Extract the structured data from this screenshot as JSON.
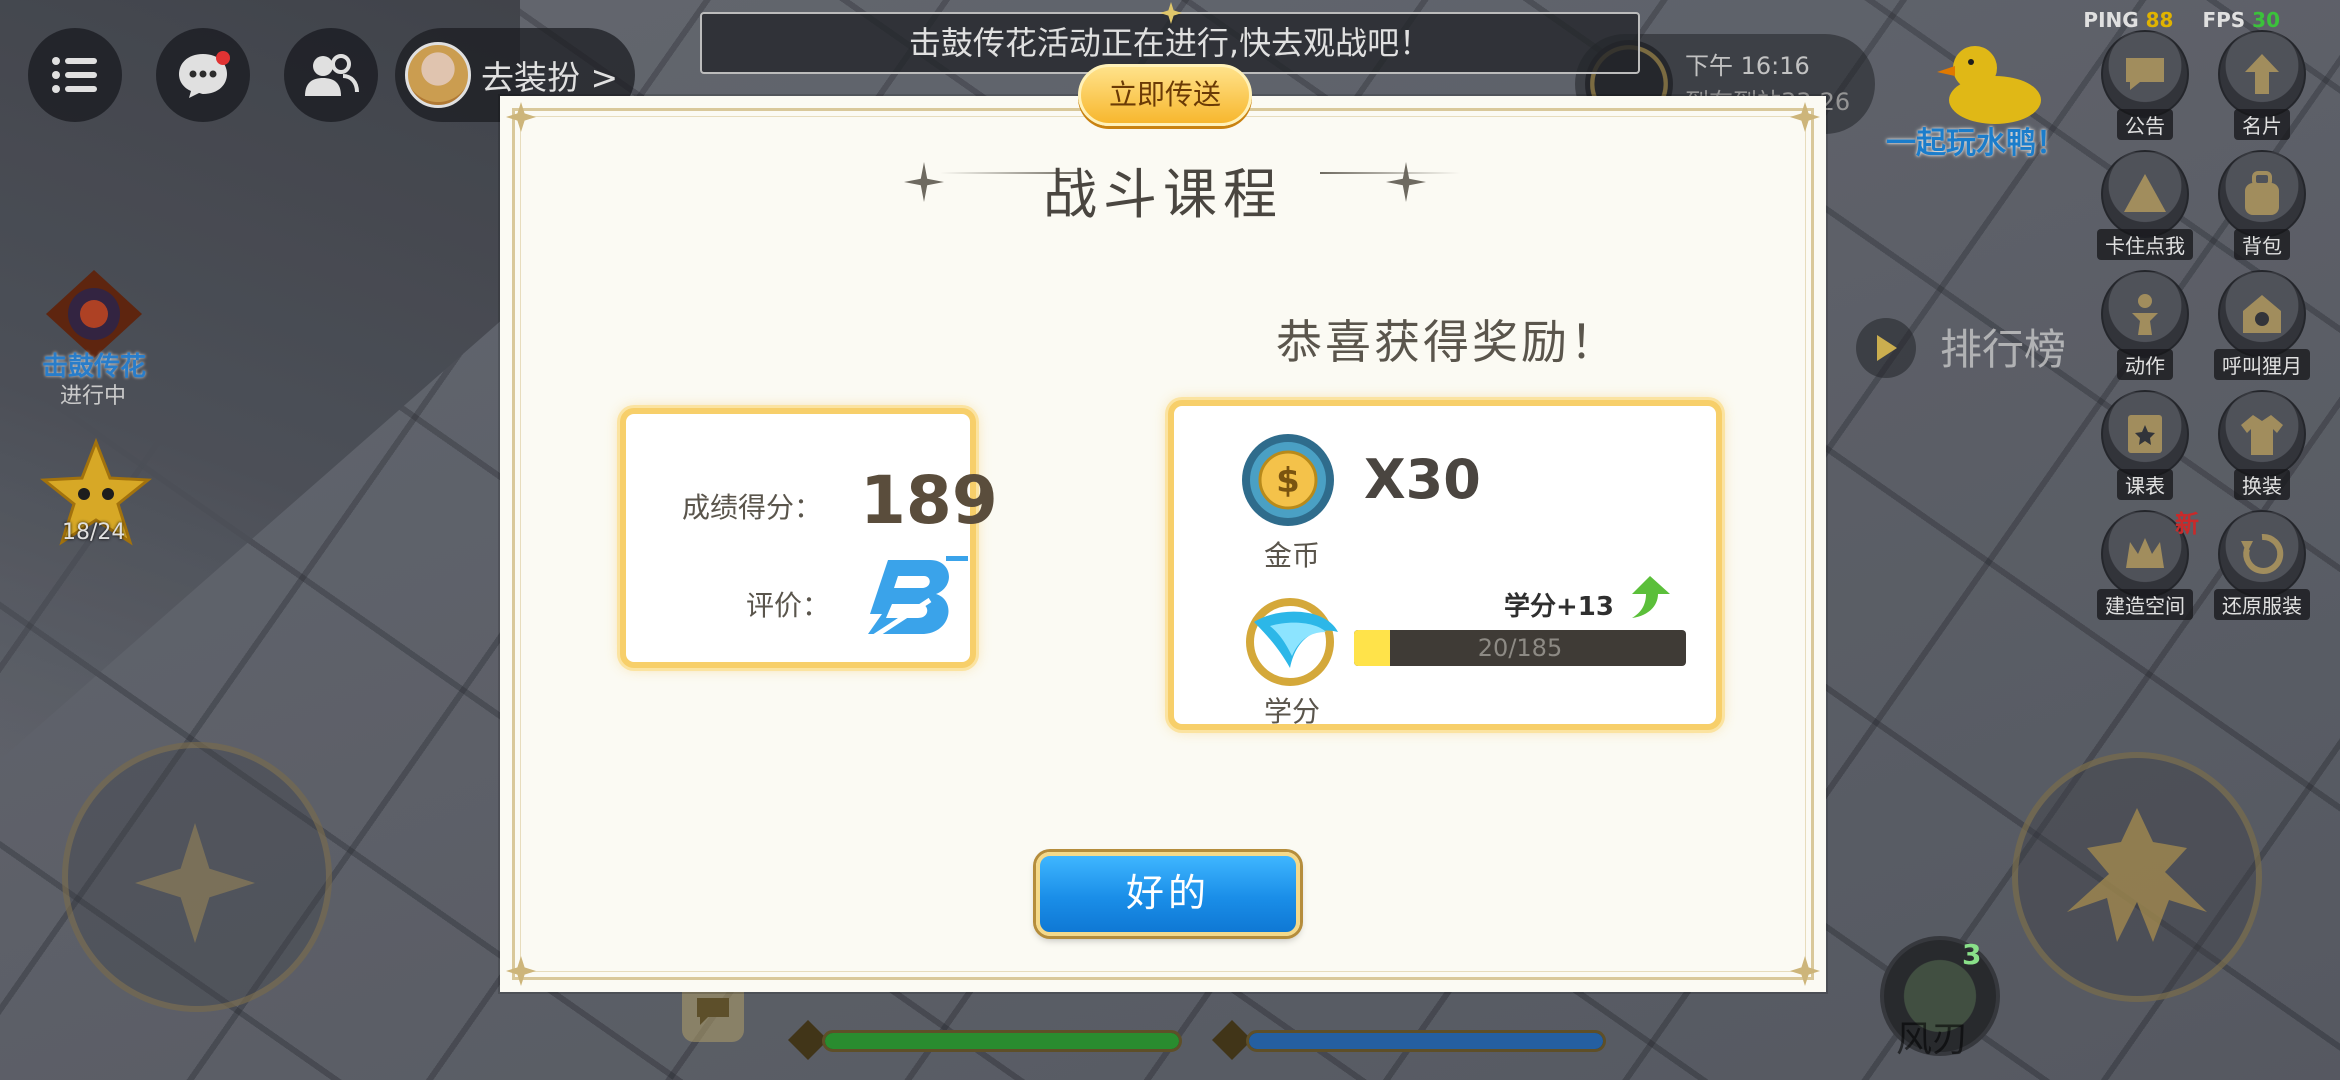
{
  "hud": {
    "banner_text": "击鼓传花活动正在进行,快去观战吧！",
    "teleport_label": "立即传送",
    "dress_label": "去装扮 >",
    "clock_time": "下午 16:16",
    "clock_sub": "到布到站33:26",
    "ping_label": "PING",
    "ping_value": "88",
    "fps_label": "FPS",
    "fps_value": "30",
    "duck_label": "一起玩水鸭！",
    "leaderboard_label": "排行榜",
    "event_title": "击鼓传花",
    "event_status": "进行中",
    "star_count": "18/24",
    "skill_label": "风刃",
    "skill_count": "3"
  },
  "menu": {
    "items": [
      {
        "label": "公告",
        "icon": "announcement-icon"
      },
      {
        "label": "名片",
        "icon": "namecard-icon"
      },
      {
        "label": "卡住点我",
        "icon": "stuck-icon"
      },
      {
        "label": "背包",
        "icon": "backpack-icon"
      },
      {
        "label": "动作",
        "icon": "action-icon"
      },
      {
        "label": "呼叫狸月",
        "icon": "call-icon"
      },
      {
        "label": "课表",
        "icon": "schedule-icon"
      },
      {
        "label": "换装",
        "icon": "outfit-icon"
      },
      {
        "label": "建造空间",
        "icon": "build-icon",
        "badge": "新"
      },
      {
        "label": "还原服装",
        "icon": "restore-icon"
      }
    ]
  },
  "dialog": {
    "title": "战斗课程",
    "congrats": "恭喜获得奖励！",
    "score_label": "成绩得分：",
    "score_value": "189",
    "grade_label": "评价：",
    "grade": "B-",
    "coin_amount": "X30",
    "coin_label": "金币",
    "credit_label": "学分",
    "credit_gain": "学分+13",
    "credit_progress": "20/185",
    "credit_fraction": 0.108,
    "ok_label": "好的"
  },
  "colors": {
    "accent_blue": "#1a8ee8",
    "card_border": "#f7cf6a",
    "ping": "#ffcc00",
    "fps": "#44dd44"
  }
}
